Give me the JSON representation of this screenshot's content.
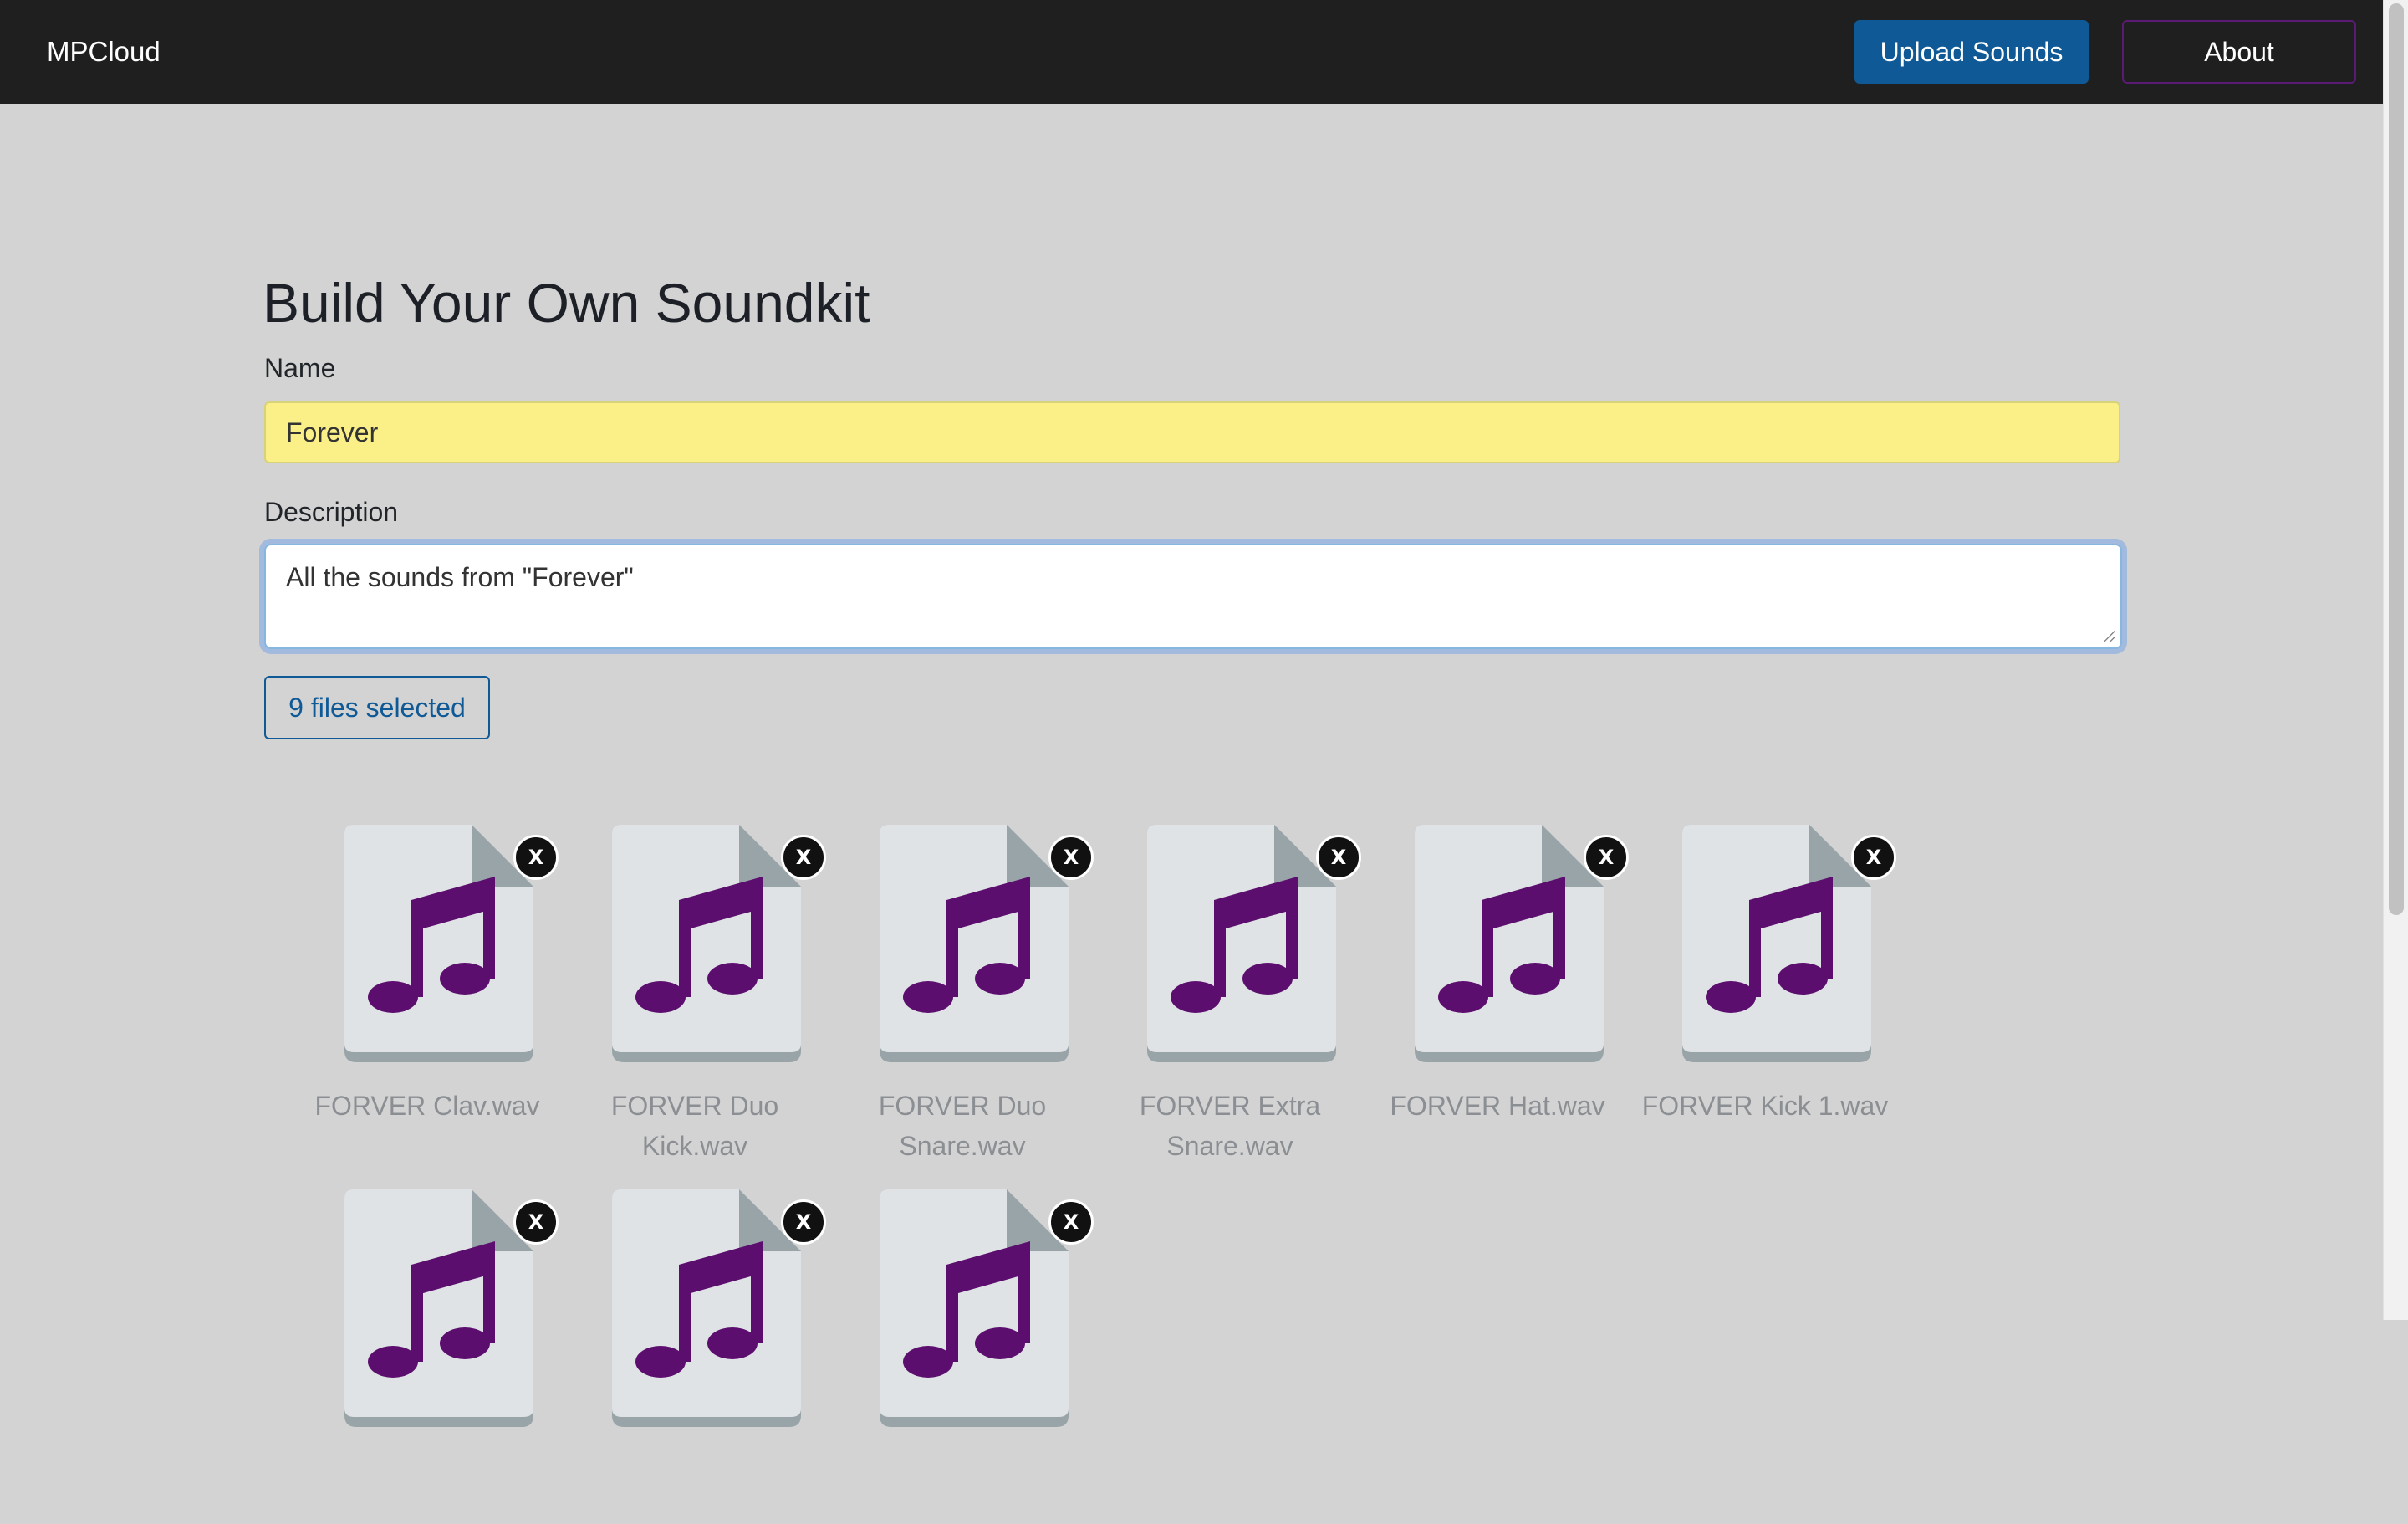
{
  "nav": {
    "brand": "MPCloud",
    "upload_label": "Upload Sounds",
    "about_label": "About",
    "colors": {
      "bar": "#1f1f1f",
      "upload": "#0f5a96",
      "about_border": "#5b1a73"
    }
  },
  "form": {
    "title": "Build Your Own Soundkit",
    "name_label": "Name",
    "name_value": "Forever",
    "description_label": "Description",
    "description_value": "All the sounds from \"Forever\"",
    "files_button": "9 files selected"
  },
  "files": [
    {
      "name": "FORVER Clav.wav",
      "icon": "music-note-icon"
    },
    {
      "name": "FORVER Duo Kick.wav",
      "icon": "music-note-icon"
    },
    {
      "name": "FORVER Duo Snare.wav",
      "icon": "music-note-icon"
    },
    {
      "name": "FORVER Extra Snare.wav",
      "icon": "music-note-icon"
    },
    {
      "name": "FORVER Hat.wav",
      "icon": "music-note-icon"
    },
    {
      "name": "FORVER Kick 1.wav",
      "icon": "music-note-icon"
    },
    {
      "name": "",
      "icon": "music-note-icon"
    },
    {
      "name": "",
      "icon": "music-note-icon"
    },
    {
      "name": "",
      "icon": "music-note-icon"
    }
  ],
  "remove_label": "X",
  "colors": {
    "page_bg": "#d3d3d3",
    "note": "#5c0e6e",
    "doc": "#e0e3e6",
    "doc_fold": "#98a4a8",
    "name_field": "#faf087"
  }
}
